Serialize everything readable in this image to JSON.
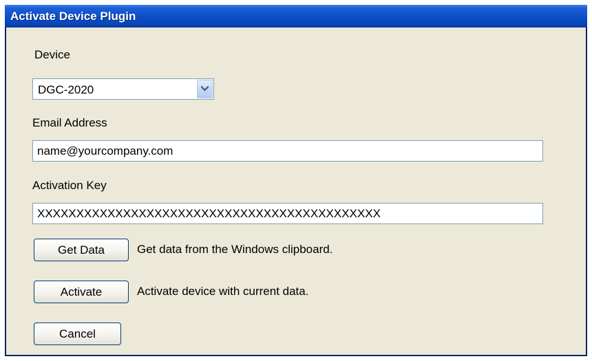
{
  "window": {
    "title": "Activate Device Plugin"
  },
  "device": {
    "label": "Device",
    "selected": "DGC-2020"
  },
  "email": {
    "label": "Email Address",
    "value": "name@yourcompany.com"
  },
  "activation_key": {
    "label": "Activation Key",
    "value": "XXXXXXXXXXXXXXXXXXXXXXXXXXXXXXXXXXXXXXXXXXXX"
  },
  "buttons": {
    "get_data": {
      "label": "Get Data",
      "description": "Get data from the Windows clipboard."
    },
    "activate": {
      "label": "Activate",
      "description": "Activate device with current data."
    },
    "cancel": {
      "label": "Cancel"
    }
  },
  "icons": {
    "dropdown": "chevron-down-icon"
  },
  "colors": {
    "titlebar": "#0a4ec8",
    "window_bg": "#ece9d8",
    "field_border": "#7f9db9"
  }
}
